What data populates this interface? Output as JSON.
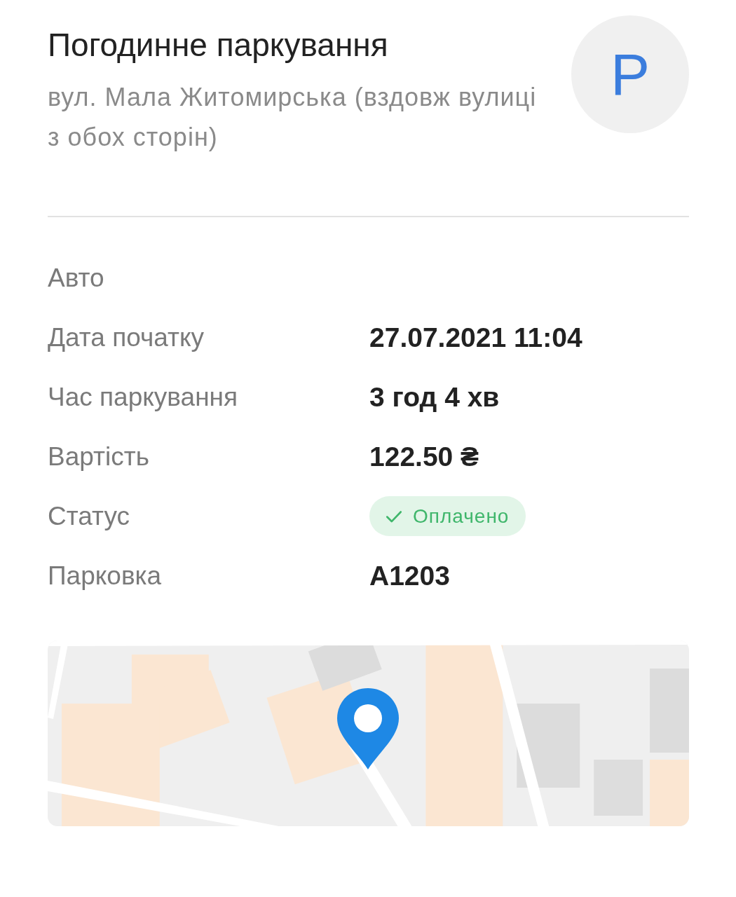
{
  "header": {
    "title": "Погодинне паркування",
    "address": "вул. Мала Житомирська (вздовж вулиці з обох сторін)",
    "avatar_letter": "P"
  },
  "details": [
    {
      "label": "Авто"
    },
    {
      "label": "Дата початку",
      "kind": "text",
      "value": "27.07.2021 11:04"
    },
    {
      "label": "Час паркування",
      "kind": "text",
      "value": "3 год 4 хв"
    },
    {
      "label": "Вартість",
      "kind": "text",
      "value": "122.50 ₴"
    },
    {
      "label": "Статус",
      "kind": "badge",
      "value": "Оплачено"
    },
    {
      "label": "Парковка",
      "kind": "text",
      "value": "A1203"
    }
  ]
}
